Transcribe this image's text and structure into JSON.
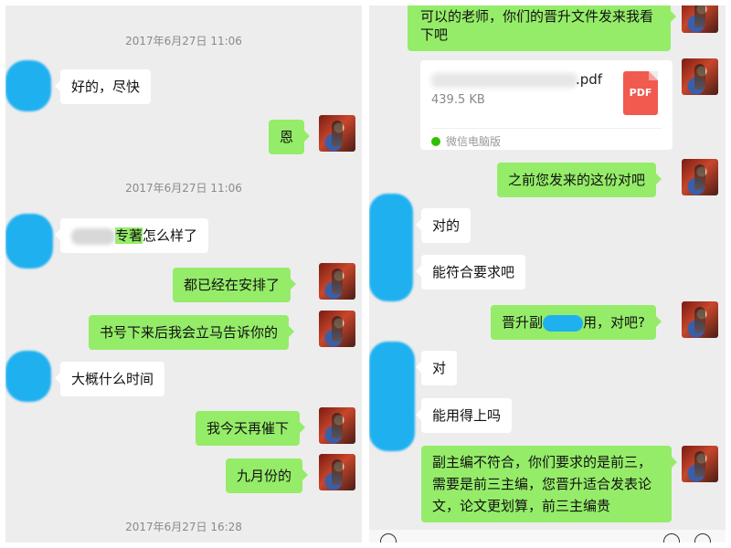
{
  "left": {
    "timestamps": [
      "2017年6月27日 11:06",
      "2017年6月27日 11:06",
      "2017年6月27日 16:28"
    ],
    "messages": [
      {
        "side": "in",
        "text": "好的，尽快"
      },
      {
        "side": "out",
        "text": "恩"
      },
      {
        "side": "in",
        "text_hl": "专著",
        "text_after": "怎么样了"
      },
      {
        "side": "out",
        "text": "都已经在安排了"
      },
      {
        "side": "out",
        "text": "书号下来后我会立马告诉你的"
      },
      {
        "side": "in",
        "text": "大概什么时间"
      },
      {
        "side": "out",
        "text": "我今天再催下"
      },
      {
        "side": "out",
        "text": "九月份的"
      }
    ]
  },
  "right": {
    "messages": [
      {
        "side": "out",
        "text": "可以的老师，你们的晋升文件发来我看下吧"
      },
      {
        "side": "out",
        "text": "之前您发来的这份对吧"
      },
      {
        "side": "in",
        "text": "对的"
      },
      {
        "side": "in",
        "text": "能符合要求吧"
      },
      {
        "side": "out",
        "text_before": "晋升副",
        "text_after": "用，对吧?"
      },
      {
        "side": "in",
        "text": "对"
      },
      {
        "side": "in",
        "text": "能用得上吗"
      },
      {
        "side": "out",
        "text": "副主编不符合，你们要求的是前三，需要是前三主编，您晋升适合发表论文，论文更划算，前三主编贵"
      }
    ],
    "file": {
      "ext": ".pdf",
      "size": "439.5 KB",
      "icon_label": "PDF",
      "source": "微信电脑版"
    }
  },
  "icons": {
    "pdf": "pdf-file-icon",
    "wechat": "wechat-icon",
    "avatar": "avatar-icon"
  },
  "colors": {
    "chat_bg": "#ededed",
    "bubble_out": "#95ec69",
    "bubble_in": "#ffffff",
    "pdf_red": "#f05a4f",
    "redaction_blue": "#1fb0f0"
  }
}
